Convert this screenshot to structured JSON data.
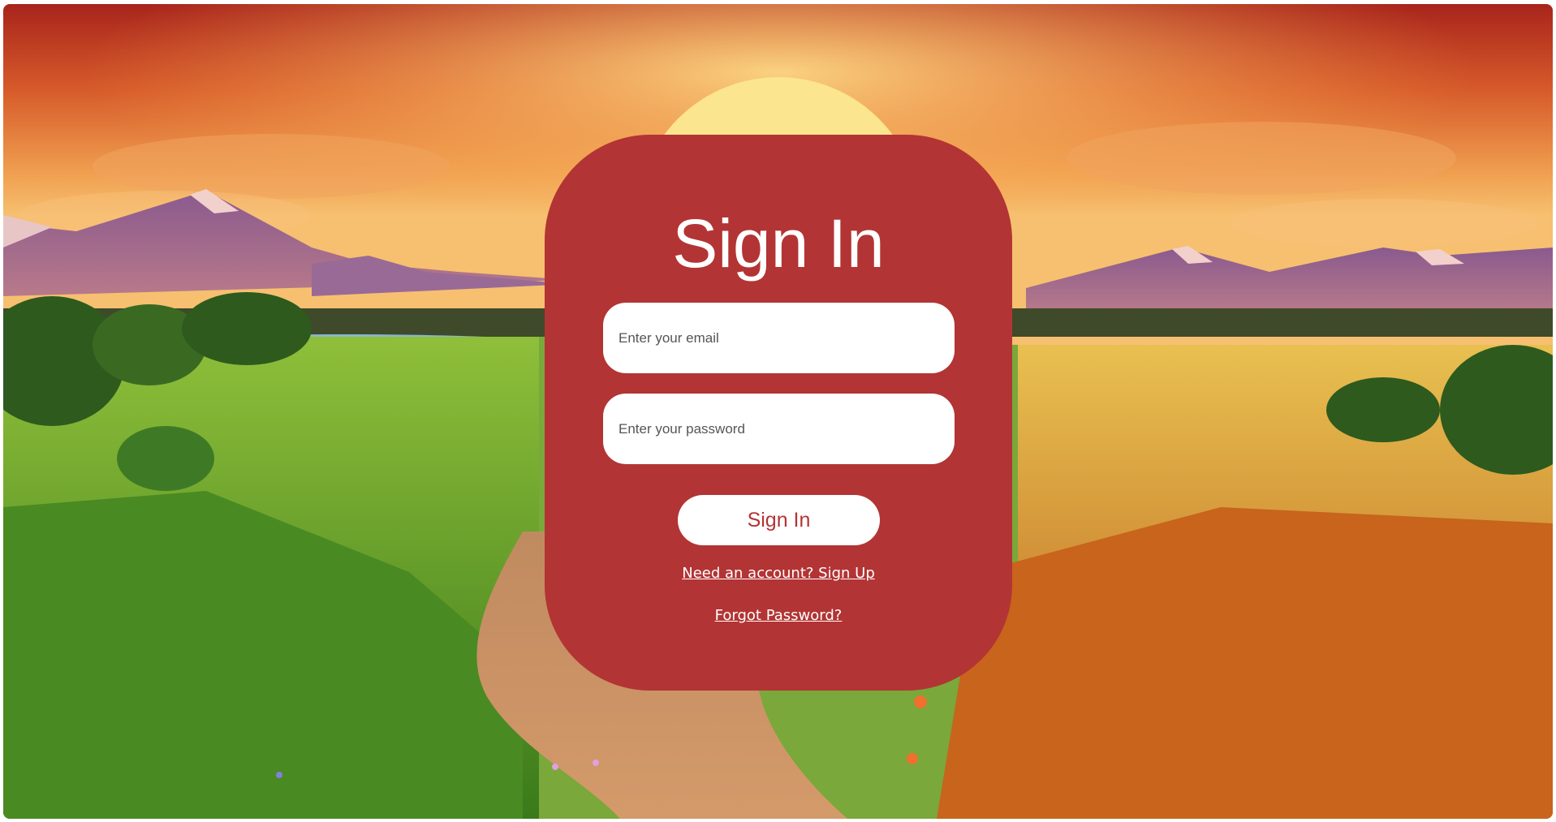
{
  "form": {
    "title": "Sign In",
    "email_placeholder": "Enter your email",
    "password_placeholder": "Enter your password",
    "submit_label": "Sign In",
    "signup_link": "Need an account? Sign Up",
    "forgot_link": "Forgot Password?"
  },
  "colors": {
    "card": "#b33434",
    "button_text": "#b33434",
    "field_bg": "#ffffff"
  }
}
